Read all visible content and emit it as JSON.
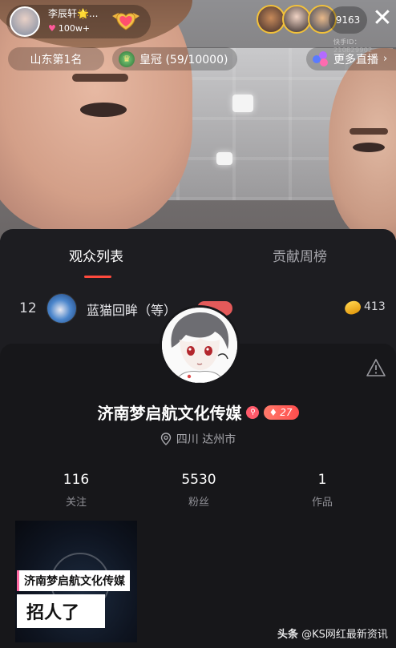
{
  "stream": {
    "anchor_name": "李辰轩🌟...",
    "anchor_likes": "100w+",
    "viewer_count": "9163",
    "room_id": "快手ID：210829902",
    "rank_label": "山东第1名",
    "crown_label": "皇冠 (59/10000)",
    "more_live_label": "更多直播",
    "colors": {
      "accent": "#ff4a3d",
      "gold": "#f3c23a"
    }
  },
  "viewer_list": {
    "tabs": [
      "观众列表",
      "贡献周榜"
    ],
    "active_tab": 0,
    "rows": [
      {
        "rank": "12",
        "name": "蓝猫回眸（等）",
        "coins": "413"
      }
    ]
  },
  "profile": {
    "name": "济南梦启航文化传媒",
    "level": "27",
    "location": "四川 达州市",
    "stats": [
      {
        "value": "116",
        "label": "关注"
      },
      {
        "value": "5530",
        "label": "粉丝"
      },
      {
        "value": "1",
        "label": "作品"
      }
    ],
    "works": [
      {
        "caption": "济南梦启航文化传媒",
        "title": "招人了"
      }
    ]
  },
  "watermark": {
    "brand": "头条",
    "handle": "@KS网红最新资讯"
  }
}
